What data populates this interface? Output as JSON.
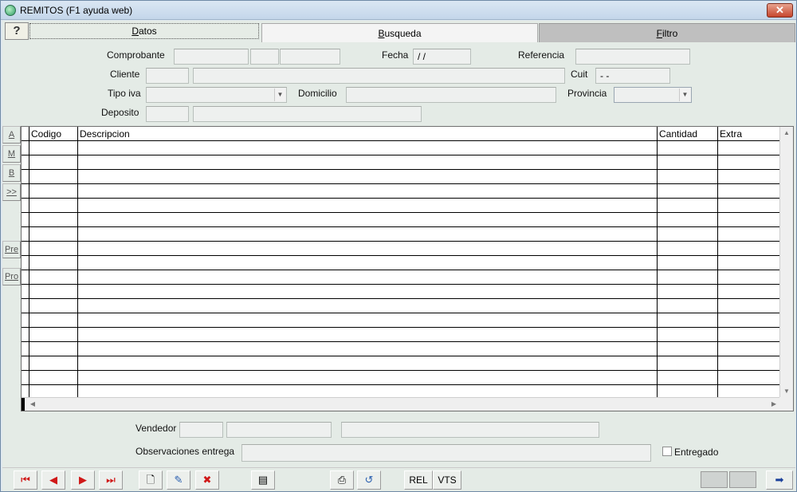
{
  "window": {
    "title": "REMITOS (F1 ayuda web)"
  },
  "tabs": [
    {
      "label": "Datos"
    },
    {
      "label": "Busqueda"
    },
    {
      "label": "Filtro"
    }
  ],
  "help_button": {
    "label": "?"
  },
  "form": {
    "comprobante_label": "Comprobante",
    "fecha_label": "Fecha",
    "fecha_value": " / /",
    "referencia_label": "Referencia",
    "cliente_label": "Cliente",
    "cuit_label": "Cuit",
    "cuit_value": " -     -",
    "tipo_iva_label": "Tipo iva",
    "domicilio_label": "Domicilio",
    "provincia_label": "Provincia",
    "deposito_label": "Deposito",
    "vendedor_label": "Vendedor",
    "observaciones_label": "Observaciones entrega",
    "entregado_label": "Entregado"
  },
  "side_buttons": [
    "A",
    "M",
    "B",
    ">>",
    "Pre",
    "Pro"
  ],
  "grid": {
    "columns": [
      "Codigo",
      "Descripcion",
      "Cantidad",
      "Extra"
    ],
    "row_count": 18
  },
  "toolbar": {
    "rel_label": "REL",
    "vts_label": "VTS"
  },
  "icons": {
    "close": "close-icon",
    "help": "help-icon",
    "first": "first-record-icon",
    "prev": "prev-record-icon",
    "next": "next-record-icon",
    "last": "last-record-icon",
    "new": "new-document-icon",
    "edit": "edit-icon",
    "delete": "delete-icon",
    "calendar": "calendar-icon",
    "print": "print-icon",
    "undo": "undo-icon",
    "exit": "exit-icon"
  },
  "colors": {
    "background": "#e4ebe6",
    "close_button": "#c6452d",
    "nav_arrow": "#d01818"
  }
}
